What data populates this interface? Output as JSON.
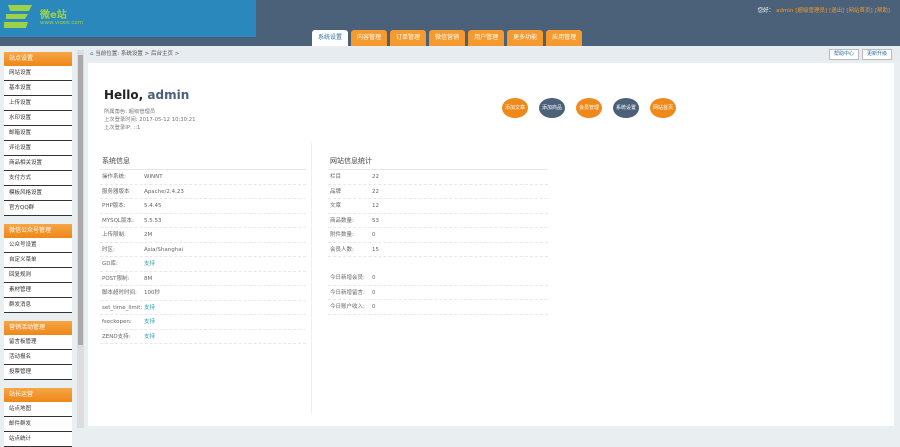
{
  "logo": {
    "name": "微e站",
    "url": "www.vioee.com"
  },
  "topbar": {
    "greeting": "您好：",
    "user": "admin",
    "links": [
      "[超级管理员]",
      "[退出]",
      "[网站首页]",
      "[帮助]"
    ]
  },
  "tabs": [
    "系统设置",
    "内容管理",
    "订单管理",
    "微信营销",
    "用户管理",
    "更多功能",
    "应用管理"
  ],
  "breadcrumb": {
    "text": "当前位置: 系统设置 > 后台主页 >",
    "buttons": [
      "帮助中心",
      "更新升级"
    ]
  },
  "sidebar": [
    {
      "title": "站点设置",
      "items": [
        "网站设置",
        "基本设置",
        "上传设置",
        "水印设置",
        "邮箱设置",
        "评论设置",
        "商品相关设置",
        "支付方式",
        "模板风格设置",
        "官方QQ群"
      ]
    },
    {
      "title": "微信公众号管理",
      "items": [
        "公众号设置",
        "自定义菜单",
        "回复规则",
        "素材管理",
        "群发消息"
      ]
    },
    {
      "title": "营销活动管理",
      "items": [
        "留言板管理",
        "活动报名",
        "投票管理"
      ]
    },
    {
      "title": "站长运营",
      "items": [
        "站点地图",
        "邮件群发",
        "站点统计"
      ]
    }
  ],
  "welcome": {
    "hello": "Hello,",
    "user": "admin",
    "role": "所属角色: 超级管理员",
    "last_login_time": "上次登录时间: 2017-05-12 10:30:21",
    "last_login_ip": "上次登录IP: ::1"
  },
  "quick_buttons": [
    {
      "label": "添加文章",
      "color": "#ef8a1a"
    },
    {
      "label": "添加商品",
      "color": "#4a6179"
    },
    {
      "label": "会员管理",
      "color": "#ef8a1a"
    },
    {
      "label": "系统设置",
      "color": "#4a6179"
    },
    {
      "label": "网站首页",
      "color": "#ef8a1a"
    }
  ],
  "system_info": {
    "title": "系统信息",
    "rows": [
      {
        "k": "操作系统:",
        "v": "WINNT"
      },
      {
        "k": "服务器版本",
        "v": "Apache/2.4.23"
      },
      {
        "k": "PHP版本:",
        "v": "5.4.45"
      },
      {
        "k": "MYSQL版本:",
        "v": "5.5.53"
      },
      {
        "k": "上传限制:",
        "v": "2M"
      },
      {
        "k": "时区:",
        "v": "Asia/Shanghai"
      },
      {
        "k": "GD库:",
        "v": "支持",
        "link": true
      },
      {
        "k": "POST限制:",
        "v": "8M"
      },
      {
        "k": "脚本超时时间:",
        "v": "100秒"
      },
      {
        "k": "set_time_limit:",
        "v": "支持",
        "link": true
      },
      {
        "k": "fsockopen:",
        "v": "支持",
        "link": true
      },
      {
        "k": "ZEND支持:",
        "v": "支持",
        "link": true
      }
    ]
  },
  "site_stats": {
    "title": "网站信息统计",
    "rows": [
      {
        "k": "栏目",
        "v": "22"
      },
      {
        "k": "品牌",
        "v": "22"
      },
      {
        "k": "文章",
        "v": "12"
      },
      {
        "k": "商品数量:",
        "v": "53"
      },
      {
        "k": "附件数量:",
        "v": "0"
      },
      {
        "k": "会员人数:",
        "v": "15"
      }
    ],
    "today": [
      {
        "k": "今日新增会员:",
        "v": "0"
      },
      {
        "k": "今日新增留言:",
        "v": "0"
      },
      {
        "k": "今日账户收入:",
        "v": "0"
      }
    ]
  }
}
